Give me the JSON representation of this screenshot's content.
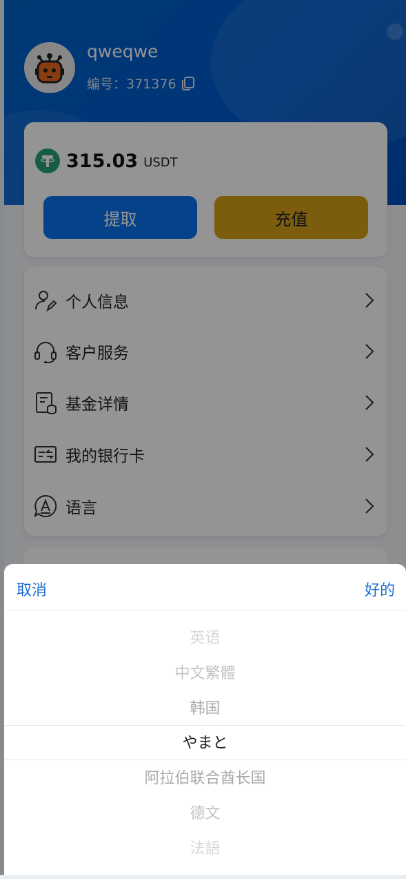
{
  "profile": {
    "username": "qweqwe",
    "id_text": "编号：371376"
  },
  "balance": {
    "amount": "315.03",
    "unit": "USDT",
    "withdraw_label": "提取",
    "deposit_label": "充值"
  },
  "menu": {
    "items": [
      {
        "label": "个人信息",
        "icon": "user-edit-icon"
      },
      {
        "label": "客户服务",
        "icon": "headset-icon"
      },
      {
        "label": "基金详情",
        "icon": "fund-doc-icon"
      },
      {
        "label": "我的银行卡",
        "icon": "bank-card-icon"
      },
      {
        "label": "语言",
        "icon": "language-icon"
      }
    ]
  },
  "picker": {
    "cancel_label": "取消",
    "ok_label": "好的",
    "options": [
      "英语",
      "中文繁體",
      "韩国",
      "やまと",
      "阿拉伯联合酋长国",
      "德文",
      "法語"
    ],
    "selected_index": 3
  },
  "colors": {
    "brand_blue": "#0a72ec",
    "deposit_gold": "#d4a017",
    "picker_link": "#1b6fd6",
    "tether_green": "#26a17b"
  }
}
